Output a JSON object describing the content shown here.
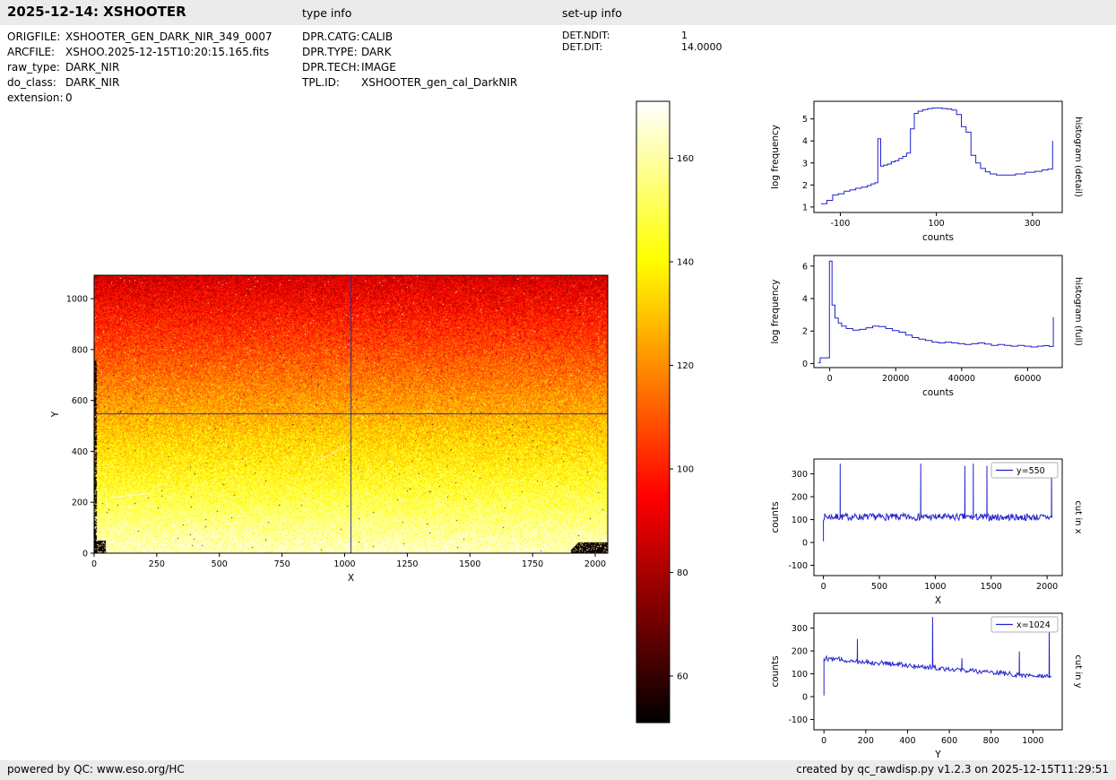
{
  "header": {
    "title": "2025-12-14: XSHOOTER",
    "type_info_heading": "type info",
    "setup_info_heading": "set-up info"
  },
  "file_info": [
    {
      "label": "ORIGFILE:",
      "value": "XSHOOTER_GEN_DARK_NIR_349_0007"
    },
    {
      "label": "ARCFILE:",
      "value": "XSHOO.2025-12-15T10:20:15.165.fits"
    },
    {
      "label": "raw_type:",
      "value": "DARK_NIR"
    },
    {
      "label": "do_class:",
      "value": "DARK_NIR"
    },
    {
      "label": "extension:",
      "value": "0"
    }
  ],
  "type_info": [
    {
      "label": "DPR.CATG:",
      "value": "CALIB"
    },
    {
      "label": "DPR.TYPE:",
      "value": "DARK"
    },
    {
      "label": "DPR.TECH:",
      "value": "IMAGE"
    },
    {
      "label": "TPL.ID:",
      "value": "XSHOOTER_gen_cal_DarkNIR"
    }
  ],
  "setup_info": [
    {
      "label": "DET.NDIT:",
      "value": "1"
    },
    {
      "label": "DET.DIT:",
      "value": "14.0000"
    }
  ],
  "footer": {
    "left": "powered by QC: www.eso.org/HC",
    "right": "created by qc_rawdisp.py v1.2.3 on 2025-12-15T11:29:51"
  },
  "colors": {
    "series": "#2222cc",
    "crosshair": "#28288f",
    "bar_bg": "#ebebeb"
  },
  "chart_data": [
    {
      "id": "detector_image",
      "type": "heatmap",
      "title": "raw dark NIR detector image",
      "xlabel": "X",
      "ylabel": "Y",
      "xlim": [
        0,
        2050
      ],
      "ylim": [
        0,
        1092
      ],
      "xticks": [
        0,
        250,
        500,
        750,
        1000,
        1250,
        1500,
        1750,
        2000
      ],
      "yticks": [
        0,
        200,
        400,
        600,
        800,
        1000
      ],
      "colormap": "hot",
      "value_top": 88,
      "value_bottom": 164,
      "noise": 13,
      "crosshair": {
        "x": 1024,
        "y": 550
      },
      "colorbar": {
        "vmin": 51,
        "vmax": 171,
        "ticks": [
          60,
          80,
          100,
          120,
          140,
          160
        ]
      }
    },
    {
      "id": "hist_detail",
      "type": "line",
      "step": true,
      "xlabel": "counts",
      "ylabel": "log frequency",
      "side_label": "histogram (detail)",
      "xlim": [
        -155,
        362
      ],
      "ylim": [
        0.75,
        5.8
      ],
      "xticks": [
        -100,
        100,
        300
      ],
      "yticks": [
        1,
        2,
        3,
        4,
        5
      ],
      "x": [
        -140,
        -128,
        -116,
        -104,
        -92,
        -80,
        -68,
        -56,
        -44,
        -36,
        -28,
        -22,
        -16,
        -10,
        -2,
        6,
        14,
        22,
        30,
        38,
        46,
        54,
        62,
        72,
        82,
        92,
        102,
        112,
        122,
        132,
        142,
        152,
        162,
        172,
        182,
        192,
        202,
        212,
        225,
        245,
        265,
        285,
        305,
        320,
        332,
        342
      ],
      "y": [
        1.15,
        1.3,
        1.55,
        1.6,
        1.72,
        1.78,
        1.85,
        1.9,
        1.97,
        2.05,
        2.1,
        4.1,
        2.85,
        2.9,
        2.95,
        3.05,
        3.1,
        3.2,
        3.3,
        3.45,
        4.55,
        5.25,
        5.35,
        5.42,
        5.47,
        5.5,
        5.5,
        5.47,
        5.45,
        5.4,
        5.2,
        4.65,
        4.4,
        3.35,
        3.0,
        2.75,
        2.6,
        2.5,
        2.45,
        2.45,
        2.5,
        2.58,
        2.62,
        2.68,
        2.72,
        4.0
      ]
    },
    {
      "id": "hist_full",
      "type": "line",
      "step": true,
      "xlabel": "counts",
      "ylabel": "log frequency",
      "side_label": "histogram (full)",
      "xlim": [
        -4800,
        70500
      ],
      "ylim": [
        -0.25,
        6.65
      ],
      "xticks": [
        0,
        20000,
        40000,
        60000
      ],
      "yticks": [
        0,
        2,
        4,
        6
      ],
      "x": [
        -3500,
        -2900,
        -100,
        700,
        1600,
        2600,
        3600,
        5000,
        7000,
        9000,
        11000,
        13000,
        15000,
        17000,
        19000,
        21000,
        23000,
        25000,
        27000,
        29000,
        31000,
        33000,
        35000,
        37000,
        39000,
        41000,
        43000,
        45000,
        47000,
        49000,
        51000,
        53000,
        55000,
        57000,
        59000,
        61000,
        63000,
        64800,
        66500,
        67800
      ],
      "y": [
        0.05,
        0.35,
        6.3,
        3.6,
        2.8,
        2.5,
        2.3,
        2.15,
        2.05,
        2.1,
        2.2,
        2.3,
        2.27,
        2.15,
        2.03,
        1.93,
        1.75,
        1.6,
        1.5,
        1.42,
        1.32,
        1.27,
        1.32,
        1.27,
        1.22,
        1.17,
        1.22,
        1.27,
        1.2,
        1.12,
        1.17,
        1.12,
        1.07,
        1.12,
        1.07,
        1.02,
        1.07,
        1.1,
        1.05,
        2.85
      ]
    },
    {
      "id": "cut_x",
      "type": "line",
      "procedural": true,
      "seed": 7,
      "xlabel": "X",
      "ylabel": "counts",
      "side_label": "cut in x",
      "legend": "y=550",
      "xlim": [
        -85,
        2135
      ],
      "ylim": [
        -145,
        365
      ],
      "xticks": [
        0,
        500,
        1000,
        1500,
        2000
      ],
      "yticks": [
        -100,
        0,
        100,
        200,
        300
      ],
      "domain": [
        0,
        2048
      ],
      "sample_step": 6,
      "baseline": [
        [
          0,
          112
        ],
        [
          2048,
          110
        ]
      ],
      "noise_amp": 15,
      "first_value": 5,
      "spikes": [
        [
          150,
          345
        ],
        [
          870,
          345
        ],
        [
          1265,
          335
        ],
        [
          1340,
          345
        ],
        [
          1462,
          335
        ],
        [
          2040,
          330
        ]
      ]
    },
    {
      "id": "cut_y",
      "type": "line",
      "procedural": true,
      "seed": 12,
      "xlabel": "Y",
      "ylabel": "counts",
      "side_label": "cut in y",
      "legend": "x=1024",
      "xlim": [
        -48,
        1140
      ],
      "ylim": [
        -145,
        365
      ],
      "xticks": [
        0,
        200,
        400,
        600,
        800,
        1000
      ],
      "yticks": [
        -100,
        0,
        100,
        200,
        300
      ],
      "domain": [
        0,
        1090
      ],
      "sample_step": 4,
      "baseline": [
        [
          0,
          168
        ],
        [
          1090,
          84
        ]
      ],
      "noise_amp": 11,
      "first_value": 5,
      "spikes": [
        [
          160,
          252
        ],
        [
          520,
          348
        ],
        [
          660,
          168
        ],
        [
          935,
          198
        ],
        [
          1078,
          302
        ]
      ]
    }
  ]
}
